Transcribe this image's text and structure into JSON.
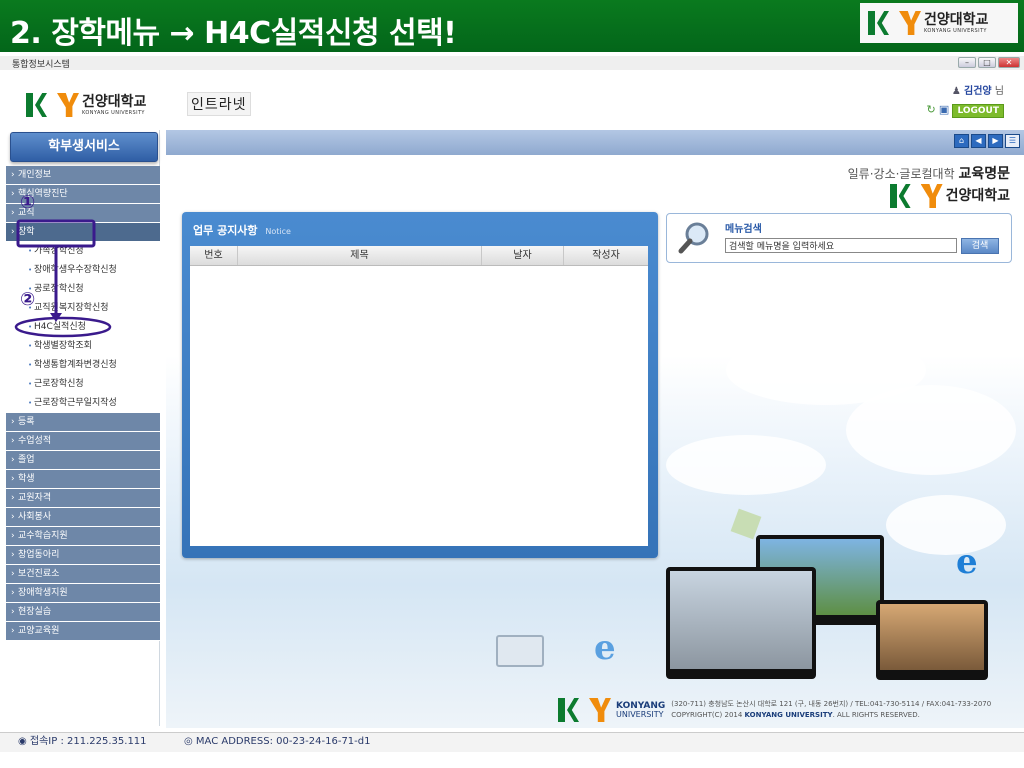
{
  "slide": {
    "title": "2. 장학메뉴 → H4C실적신청 선택!"
  },
  "brand": {
    "kr": "건양대학교",
    "en": "KONYANG UNIVERSITY"
  },
  "window": {
    "title": "통합정보시스템"
  },
  "header": {
    "intranet": "인트라넷",
    "user_name": "김건양",
    "user_suffix": "님",
    "logout": "LOGOUT"
  },
  "sidebar": {
    "service_button": "학부생서비스",
    "items": [
      {
        "label": "개인정보",
        "type": "cat"
      },
      {
        "label": "핵심역량진단",
        "type": "cat"
      },
      {
        "label": "교직",
        "type": "cat"
      },
      {
        "label": "장학",
        "type": "cat-active"
      },
      {
        "label": "가족장학신청",
        "type": "sub"
      },
      {
        "label": "장애학생우수장학신청",
        "type": "sub"
      },
      {
        "label": "공로장학신청",
        "type": "sub"
      },
      {
        "label": "교직원복지장학신청",
        "type": "sub"
      },
      {
        "label": "H4C실적신청",
        "type": "sub"
      },
      {
        "label": "학생별장학조회",
        "type": "sub"
      },
      {
        "label": "학생통합계좌변경신청",
        "type": "sub"
      },
      {
        "label": "근로장학신청",
        "type": "sub"
      },
      {
        "label": "근로장학근무일지작성",
        "type": "sub"
      },
      {
        "label": "등록",
        "type": "cat"
      },
      {
        "label": "수업성적",
        "type": "cat"
      },
      {
        "label": "졸업",
        "type": "cat"
      },
      {
        "label": "학생",
        "type": "cat"
      },
      {
        "label": "교원자격",
        "type": "cat"
      },
      {
        "label": "사회봉사",
        "type": "cat"
      },
      {
        "label": "교수학습지원",
        "type": "cat"
      },
      {
        "label": "창업동아리",
        "type": "cat"
      },
      {
        "label": "보건진료소",
        "type": "cat"
      },
      {
        "label": "장애학생지원",
        "type": "cat"
      },
      {
        "label": "현장실습",
        "type": "cat"
      },
      {
        "label": "교양교육원",
        "type": "cat"
      }
    ]
  },
  "annotations": {
    "step1": "①",
    "step2": "②"
  },
  "main": {
    "motto_small": "일류·강소·글로컬대학",
    "motto_bold": "교육명문",
    "notice": {
      "title": "업무 공지사항",
      "title_en": "Notice",
      "columns": [
        "번호",
        "제목",
        "날자",
        "작성자"
      ]
    },
    "search": {
      "title": "메뉴검색",
      "value": "검색할 메뉴명을 입력하세요",
      "button": "검색"
    },
    "footer": {
      "line1": "(320-711) 충청남도 논산시 대학로 121 (구, 내동 26번지) / TEL:041-730-5114 / FAX:041-733-2070",
      "line2_pre": "COPYRIGHT(C) 2014 ",
      "line2_bold": "KONYANG UNIVERSITY",
      "line2_post": ". ALL RIGHTS RESERVED."
    }
  },
  "status_bar": {
    "ip": "접속IP : 211.225.35.111",
    "mac": "MAC ADDRESS: 00-23-24-16-71-d1"
  },
  "colors": {
    "slide_header": "#03661a",
    "menu_cat": "#6e87a8",
    "accent_blue": "#3573b8",
    "logout_green": "#7dbb2c",
    "annotation": "#3a1a8c"
  }
}
